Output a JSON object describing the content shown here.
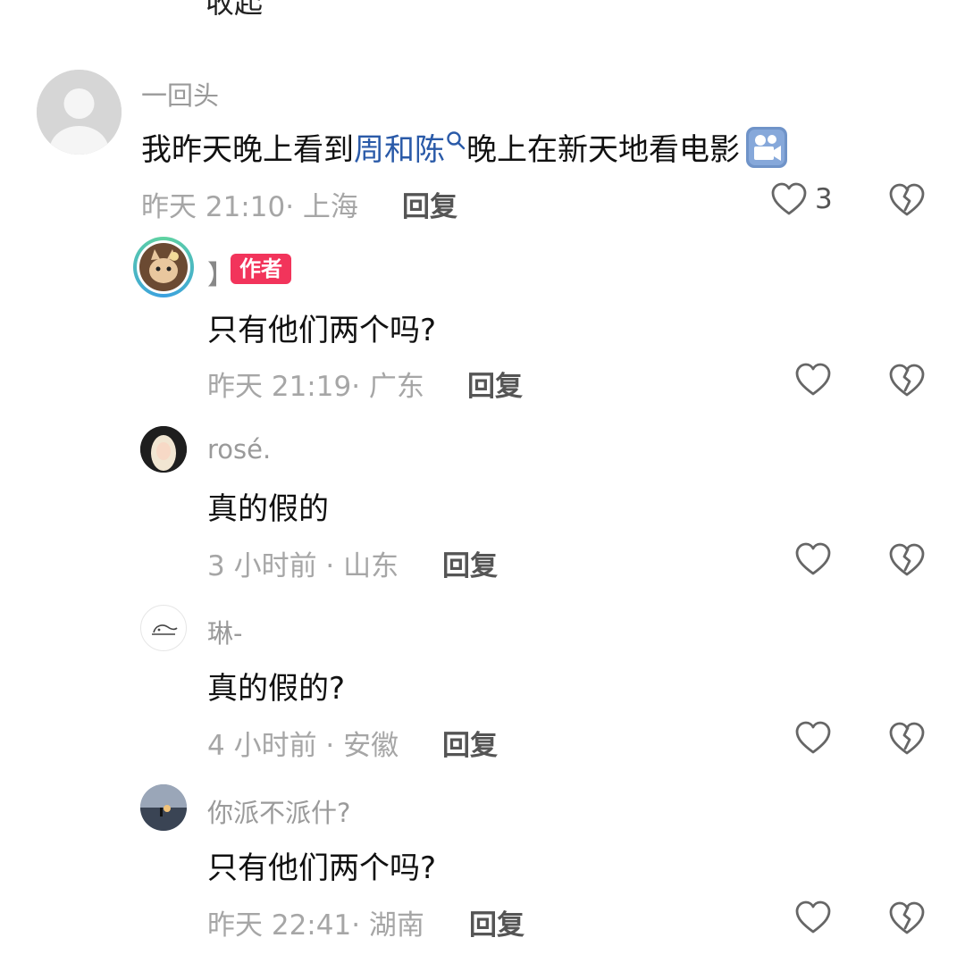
{
  "cut_top_text": "收起",
  "comment": {
    "user": "一回头",
    "text_before": "我昨天晚上看到",
    "topic": "周和陈",
    "text_after": "晚上在新天地看电影",
    "meta": "昨天 21:10· 上海",
    "reply_label": "回复",
    "like_count": "3"
  },
  "replies": [
    {
      "user": "】",
      "badge": "作者",
      "text": "只有他们两个吗?",
      "meta": "昨天 21:19· 广东",
      "reply_label": "回复"
    },
    {
      "user": "rosé.",
      "text": "真的假的",
      "meta": "3 小时前 · 山东",
      "reply_label": "回复"
    },
    {
      "user": "琳-",
      "text": "真的假的?",
      "meta": "4 小时前 · 安徽",
      "reply_label": "回复"
    },
    {
      "user": "你派不派什?",
      "text": "只有他们两个吗?",
      "meta": "昨天 22:41· 湖南",
      "reply_label": "回复"
    }
  ],
  "colors": {
    "topic_link": "#2a5aa8",
    "author_badge": "#f2345b",
    "muted_text": "#a6a6a6"
  }
}
